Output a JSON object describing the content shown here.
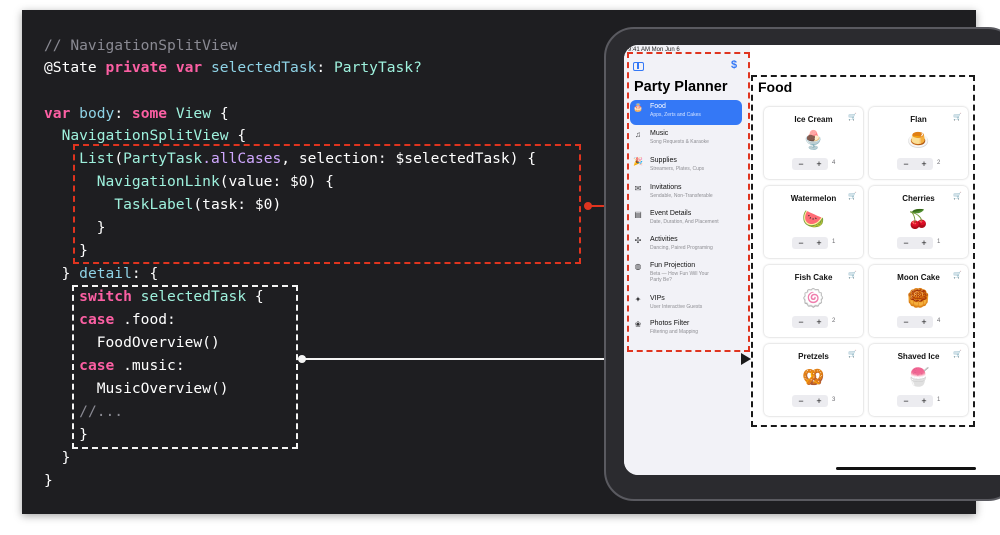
{
  "colors": {
    "background": "#1e1e21",
    "keyword": "#fc5fa3",
    "type": "#9ef1dd",
    "comment": "#8a8a93",
    "accent": "#3478f6",
    "red_dashed": "#e0341f",
    "white_dashed": "#f4f4f4"
  },
  "code": {
    "line1": "// NavigationSplitView",
    "line2_attr": "@State",
    "line2_kw1": "private",
    "line2_kw2": "var",
    "line2_name": "selectedTask",
    "line2_colon": ":",
    "line2_type": "PartyTask?",
    "line4_kw1": "var",
    "line4_name": "body",
    "line4_colon": ":",
    "line4_kw2": "some",
    "line4_type": "View",
    "line4_brace": "{",
    "line5_type": "NavigationSplitView",
    "line5_brace": "{",
    "line6_type": "List",
    "line6_open": "(",
    "line6_enum": "PartyTask",
    "line6_case": ".allCases",
    "line6_mid": ", selection:",
    "line6_binding": "$selectedTask",
    "line6_close": ") {",
    "line7_type": "NavigationLink",
    "line7_rest": "(value: $0) {",
    "line8_type": "TaskLabel",
    "line8_rest": "(task: $0)",
    "line9": "}",
    "line10": "}",
    "line11_start": "} ",
    "line11_detail": "detail",
    "line11_end": ": {",
    "line12_kw": "switch",
    "line12_var": "selectedTask",
    "line12_brace": "{",
    "line13_kw": "case",
    "line13_case": ".food:",
    "line14_type": "FoodOverview",
    "line14_paren": "()",
    "line15_kw": "case",
    "line15_case": ".music:",
    "line16_type": "MusicOverview",
    "line16_paren": "()",
    "line17": "//...",
    "line18": "}",
    "line19": "}",
    "line20": "}"
  },
  "ipad": {
    "status_time": "9:41 AM   Mon Jun 6",
    "sidebar_toggle_icon": "sidebar-icon",
    "dollar_icon": "$",
    "sidebar_title": "Party Planner",
    "sidebar_items": [
      {
        "icon": "🎂",
        "label": "Food",
        "sub": "Apps, Zerts and Cakes",
        "selected": true
      },
      {
        "icon": "♫",
        "label": "Music",
        "sub": "Song Requests & Karaoke",
        "selected": false
      },
      {
        "icon": "🎉",
        "label": "Supplies",
        "sub": "Streamers, Plates, Cups",
        "selected": false
      },
      {
        "icon": "✉",
        "label": "Invitations",
        "sub": "Sendable, Non-Transferable",
        "selected": false
      },
      {
        "icon": "▤",
        "label": "Event Details",
        "sub": "Date, Duration, And Placement",
        "selected": false
      },
      {
        "icon": "✣",
        "label": "Activities",
        "sub": "Dancing, Paired Programing",
        "selected": false
      },
      {
        "icon": "◍",
        "label": "Fun Projection",
        "sub": "Beta — How Fun Will Your",
        "sub2": "Party Be?",
        "selected": false
      },
      {
        "icon": "✦",
        "label": "VIPs",
        "sub": "User Interactive Guests",
        "selected": false
      },
      {
        "icon": "❀",
        "label": "Photos Filter",
        "sub": "Filtering and Mapping",
        "selected": false
      }
    ],
    "detail_title": "Food",
    "food_items": [
      {
        "name": "Ice Cream",
        "emoji": "🍨",
        "qty": "4"
      },
      {
        "name": "Flan",
        "emoji": "🍮",
        "qty": "2"
      },
      {
        "name": "Watermelon",
        "emoji": "🍉",
        "qty": "1"
      },
      {
        "name": "Cherries",
        "emoji": "🍒",
        "qty": "1"
      },
      {
        "name": "Fish Cake",
        "emoji": "🍥",
        "qty": "2"
      },
      {
        "name": "Moon Cake",
        "emoji": "🥮",
        "qty": "4"
      },
      {
        "name": "Pretzels",
        "emoji": "🥨",
        "qty": "3"
      },
      {
        "name": "Shaved Ice",
        "emoji": "🍧",
        "qty": "1"
      }
    ],
    "stepper_minus": "−",
    "stepper_plus": "+",
    "cart_icon": "🛒"
  }
}
